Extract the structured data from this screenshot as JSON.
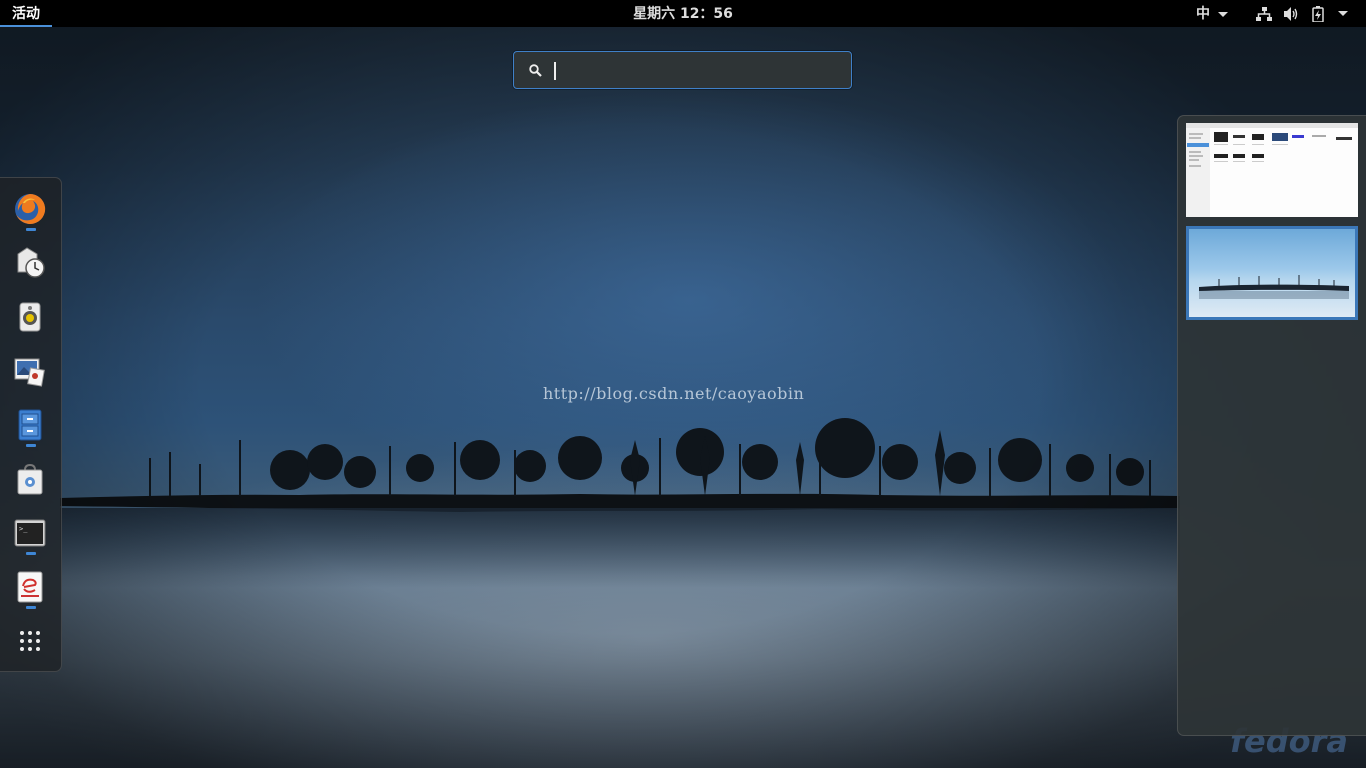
{
  "topbar": {
    "activities_label": "活动",
    "clock": "星期六 12：56",
    "input_method": "中"
  },
  "search": {
    "placeholder": "",
    "value": ""
  },
  "wallpaper": {
    "watermark": "http://blog.csdn.net/caoyaobin",
    "brand": "fedora"
  },
  "dash": {
    "items": [
      {
        "icon": "firefox-icon",
        "running": true
      },
      {
        "icon": "backup-clock-icon",
        "running": false
      },
      {
        "icon": "rhythmbox-speaker-icon",
        "running": false
      },
      {
        "icon": "image-viewer-icon",
        "running": false
      },
      {
        "icon": "files-cabinet-icon",
        "running": true
      },
      {
        "icon": "software-bag-icon",
        "running": false
      },
      {
        "icon": "terminal-icon",
        "running": true
      },
      {
        "icon": "eclipse-doc-icon",
        "running": true
      },
      {
        "icon": "show-applications-grid-icon",
        "running": false
      }
    ]
  },
  "workspaces": [
    {
      "name": "workspace-1",
      "active": false
    },
    {
      "name": "workspace-2",
      "active": true
    }
  ],
  "colors": {
    "accent": "#3e86d5",
    "topbar": "#000000",
    "panel": "#2e3436"
  }
}
